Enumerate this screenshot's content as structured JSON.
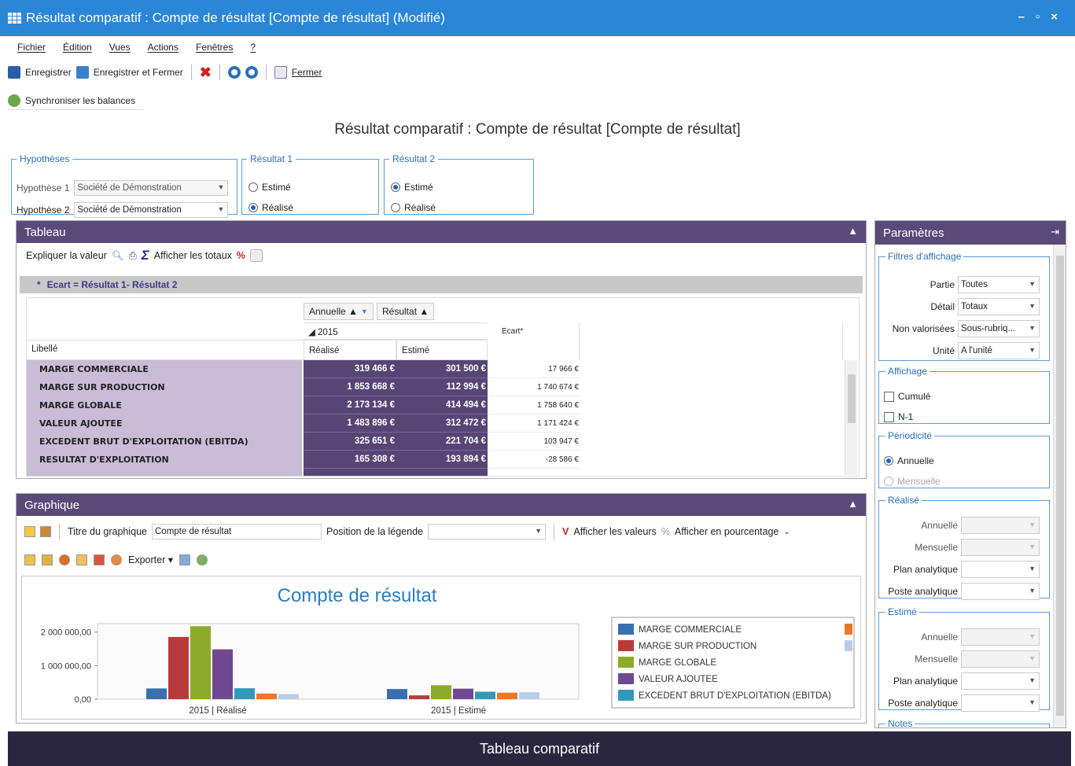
{
  "window": {
    "title": "Résultat comparatif : Compte de résultat [Compte de résultat] (Modifié)",
    "minimize": "–",
    "maximize": "▫",
    "close": "×"
  },
  "menu": [
    "Fichier",
    "Édition",
    "Vues",
    "Actions",
    "Fenêtres",
    "?"
  ],
  "toolbar": {
    "save": "Enregistrer",
    "save_close": "Enregistrer et Fermer",
    "close": "Fermer"
  },
  "sync": {
    "label": "Synchroniser les balances"
  },
  "doc_title": "Résultat comparatif : Compte de résultat [Compte de résultat]",
  "hypotheses": {
    "legend": "Hypothèses",
    "h1_label": "Hypothèse 1",
    "h1_value": "Société de Démonstration",
    "h2_label": "Hypothèse 2",
    "h2_value": "Société de Démonstration"
  },
  "resultat1": {
    "legend": "Résultat 1",
    "opt1": "Estimé",
    "opt2": "Réalisé",
    "selected": "Réalisé"
  },
  "resultat2": {
    "legend": "Résultat 2",
    "opt1": "Estimé",
    "opt2": "Réalisé",
    "selected": "Estimé"
  },
  "tableau": {
    "title": "Tableau",
    "explain": "Expliquer la valeur",
    "totals": "Afficher les totaux",
    "ecart_formula": "Ecart = Résultat 1- Résultat 2",
    "pivot1": "Annuelle ▲",
    "pivot2": "Résultat ▲",
    "year": "◢ 2015",
    "col_libelle": "Libellé",
    "col_realise": "Réalisé",
    "col_estime": "Estimé",
    "col_ecart": "Ecart*",
    "rows": [
      {
        "label": "MARGE COMMERCIALE",
        "realise": "319 466 €",
        "estime": "301 500 €",
        "ecart": "17 966 €"
      },
      {
        "label": "MARGE SUR PRODUCTION",
        "realise": "1 853 668 €",
        "estime": "112 994 €",
        "ecart": "1 740 674 €"
      },
      {
        "label": "MARGE GLOBALE",
        "realise": "2 173 134 €",
        "estime": "414 494 €",
        "ecart": "1 758 640 €"
      },
      {
        "label": "VALEUR AJOUTEE",
        "realise": "1 483 896 €",
        "estime": "312 472 €",
        "ecart": "1 171 424 €"
      },
      {
        "label": "EXCEDENT BRUT D'EXPLOITATION (EBITDA)",
        "realise": "325 651 €",
        "estime": "221 704 €",
        "ecart": "103 947 €"
      },
      {
        "label": "RESULTAT D'EXPLOITATION",
        "realise": "165 308 €",
        "estime": "193 894 €",
        "ecart": "-28 586 €"
      }
    ]
  },
  "graphique": {
    "title": "Graphique",
    "chart_title_label": "Titre du graphique",
    "chart_title_value": "Compte de résultat",
    "legend_pos_label": "Position de la légende",
    "show_values": "Afficher les valeurs",
    "show_pct": "Afficher en pourcentage",
    "export": "Exporter"
  },
  "chart_data": {
    "type": "bar",
    "title": "Compte de résultat",
    "categories": [
      "2015 | Réalisé",
      "2015 | Estimé"
    ],
    "ytick_labels": [
      "2 000 000,00",
      "1 000 000,00",
      "0,00"
    ],
    "ylim": [
      0,
      2250000
    ],
    "series": [
      {
        "name": "MARGE COMMERCIALE",
        "color": "#3a6fad",
        "values": [
          319466,
          301500
        ]
      },
      {
        "name": "MARGE SUR PRODUCTION",
        "color": "#b93a3a",
        "values": [
          1853668,
          112994
        ]
      },
      {
        "name": "MARGE GLOBALE",
        "color": "#8cab2a",
        "values": [
          2173134,
          414494
        ]
      },
      {
        "name": "VALEUR AJOUTEE",
        "color": "#6f4a92",
        "values": [
          1483896,
          312472
        ]
      },
      {
        "name": "EXCEDENT BRUT D'EXPLOITATION (EBITDA)",
        "color": "#3399bb",
        "values": [
          325651,
          221704
        ]
      },
      {
        "color": "#e67a2a",
        "values": [
          165308,
          193894
        ]
      },
      {
        "color": "#b7cde8",
        "values": [
          150000,
          205000
        ]
      }
    ],
    "legend_position": "right"
  },
  "parametres": {
    "title": "Paramètres",
    "filtres": {
      "legend": "Filtres d'affichage",
      "partie_label": "Partie",
      "partie_value": "Toutes",
      "detail_label": "Détail",
      "detail_value": "Totaux",
      "nonval_label": "Non valorisées",
      "nonval_value": "Sous-rubriq...",
      "unite_label": "Unité",
      "unite_value": "A l'unité"
    },
    "affichage": {
      "legend": "Affichage",
      "cumule": "Cumulé",
      "n1": "N-1"
    },
    "periodicite": {
      "legend": "Périodicité",
      "annuelle": "Annuelle",
      "mensuelle": "Mensuelle"
    },
    "realise": {
      "legend": "Réalisé",
      "annuelle": "Annuelle",
      "mensuelle": "Mensuelle",
      "plan": "Plan analytique",
      "poste": "Poste analytique"
    },
    "estime": {
      "legend": "Estimé",
      "annuelle": "Annuelle",
      "mensuelle": "Mensuelle",
      "plan": "Plan analytique",
      "poste": "Poste analytique"
    },
    "notes": {
      "legend": "Notes"
    }
  },
  "footer": "Tableau comparatif"
}
